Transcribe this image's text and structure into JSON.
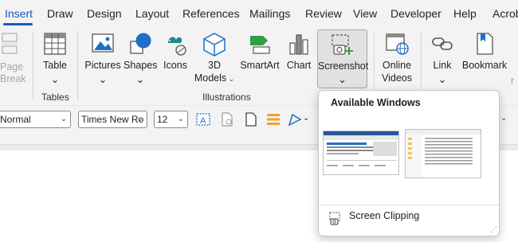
{
  "menu_tabs": [
    "Insert",
    "Draw",
    "Design",
    "Layout",
    "References",
    "Mailings",
    "Review",
    "View",
    "Developer",
    "Help",
    "Acrob"
  ],
  "ribbon": {
    "page_break": {
      "line1": "Page",
      "line2": "Break"
    },
    "table": {
      "label": "Table"
    },
    "pictures": {
      "label": "Pictures"
    },
    "shapes": {
      "label": "Shapes"
    },
    "icons": {
      "label": "Icons"
    },
    "models_3d": {
      "line1": "3D",
      "line2": "Models"
    },
    "smartart": {
      "label": "SmartArt"
    },
    "chart": {
      "label": "Chart"
    },
    "screenshot": {
      "label": "Screenshot"
    },
    "online_videos": {
      "line1": "Online",
      "line2": "Videos"
    },
    "link": {
      "label": "Link"
    },
    "bookmark": {
      "label": "Bookmark"
    },
    "groups": {
      "tables": "Tables",
      "illustrations": "Illustrations"
    }
  },
  "toolbar": {
    "style_value": "Normal",
    "font_value": "Times New Ro",
    "size_value": "12"
  },
  "dropdown": {
    "title": "Available Windows",
    "thumbnails": [
      "window-thumbnail-document",
      "window-thumbnail-file-explorer"
    ],
    "screen_clipping": "Screen Clipping"
  },
  "colors": {
    "accent": "#185abd",
    "green": "#2f9e44",
    "teal": "#1c8a8a"
  }
}
